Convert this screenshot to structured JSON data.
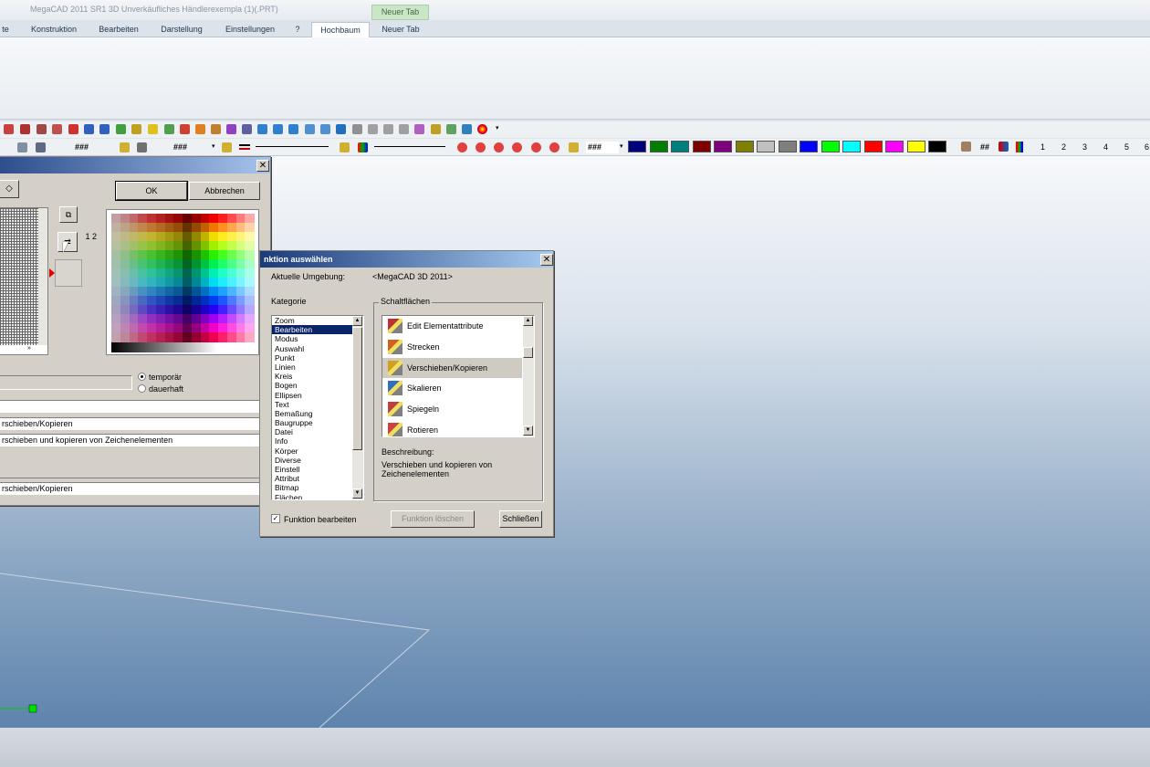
{
  "window": {
    "title": "MegaCAD 2011 SR1 3D  Unverkäufliches Händlerexempla (1)(.PRT)",
    "context_tab": "Neuer Tab"
  },
  "ribbon": {
    "tabs": [
      "te",
      "Konstruktion",
      "Bearbeiten",
      "Darstellung",
      "Einstellungen",
      "?",
      "Hochbaum",
      "Neuer Tab"
    ],
    "active_tab": "Hochbaum"
  },
  "toolbar": {
    "field1": "###",
    "field2": "###",
    "field3": "###",
    "hash_symbol": "##",
    "layer_numbers": [
      "1",
      "2",
      "3",
      "4",
      "5",
      "6"
    ],
    "palette": [
      "#00007f",
      "#007f00",
      "#007f7f",
      "#7f0000",
      "#7f007f",
      "#7f7f00",
      "#c0c0c0",
      "#7f7f7f",
      "#0000ff",
      "#00ff00",
      "#00ffff",
      "#ff0000",
      "#ff00ff",
      "#ffff00",
      "#000000"
    ]
  },
  "left_dialog": {
    "ok_label": "OK",
    "cancel_label": "Abbrechen",
    "option_temp": "temporär",
    "option_perm": "dauerhaft",
    "field_name": "rschieben/Kopieren",
    "field_desc": "rschieben und kopieren von Zeichenelementen",
    "field_tooltip": "rschieben/Kopieren",
    "order_label": "1 2"
  },
  "func_dialog": {
    "title": "nktion auswählen",
    "env_label": "Aktuelle Umgebung:",
    "env_value": "<MegaCAD 3D 2011>",
    "category_label": "Kategorie",
    "categories": [
      "Zoom",
      "Bearbeiten",
      "Modus",
      "Auswahl",
      "Punkt",
      "Linien",
      "Kreis",
      "Bogen",
      "Ellipsen",
      "Text",
      "Bemaßung",
      "Baugruppe",
      "Datei",
      "Info",
      "Körper",
      "Diverse",
      "Einstell",
      "Attribut",
      "Bitmap",
      "Flächen"
    ],
    "selected_category": "Bearbeiten",
    "buttons_label": "Schaltflächen",
    "functions": [
      {
        "label": "Edit Elementattribute",
        "icon": "edit-attributes-icon"
      },
      {
        "label": "Strecken",
        "icon": "stretch-icon"
      },
      {
        "label": "Verschieben/Kopieren",
        "icon": "move-copy-icon"
      },
      {
        "label": "Skalieren",
        "icon": "scale-icon"
      },
      {
        "label": "Spiegeln",
        "icon": "mirror-icon"
      },
      {
        "label": "Rotieren",
        "icon": "rotate-icon"
      }
    ],
    "selected_function": "Verschieben/Kopieren",
    "description_label": "Beschreibung:",
    "description_text": "Verschieben und kopieren von Zeichenelementen",
    "edit_checkbox_label": "Funktion bearbeiten",
    "delete_button": "Funktion löschen",
    "close_button": "Schließen"
  }
}
